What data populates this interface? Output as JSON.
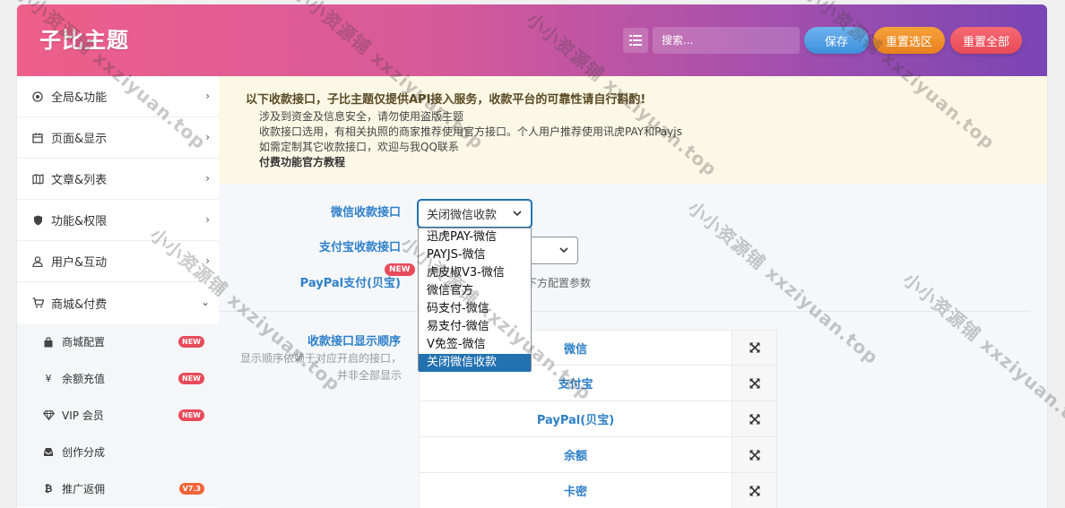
{
  "header": {
    "title": "子比主题",
    "search_placeholder": "搜索...",
    "save_label": "保存",
    "reset_section_label": "重置选区",
    "reset_all_label": "重置全部"
  },
  "sidebar": {
    "items": [
      {
        "label": "全局&功能",
        "icon": "target-icon"
      },
      {
        "label": "页面&显示",
        "icon": "calendar-icon"
      },
      {
        "label": "文章&列表",
        "icon": "map-icon"
      },
      {
        "label": "功能&权限",
        "icon": "shield-icon"
      },
      {
        "label": "用户&互动",
        "icon": "user-icon"
      },
      {
        "label": "商城&付费",
        "icon": "cart-icon"
      }
    ],
    "sub_items": [
      {
        "label": "商城配置",
        "icon": "shopping-bag-icon",
        "badge": "NEW"
      },
      {
        "label": "余额充值",
        "icon": "yen-icon",
        "badge": "NEW"
      },
      {
        "label": "VIP 会员",
        "icon": "diamond-icon",
        "badge": "NEW"
      },
      {
        "label": "创作分成",
        "icon": "inbox-icon",
        "badge": ""
      },
      {
        "label": "推广返佣",
        "icon": "bitcoin-icon",
        "badge": "V7.3"
      }
    ]
  },
  "notice": {
    "title": "以下收款接口，子比主题仅提供API接入服务，收款平台的可靠性请自行斟酌!",
    "lines": [
      "涉及到资金及信息安全，请勿使用盗版主题",
      "收款接口选用，有相关执照的商家推荐使用官方接口。个人用户推荐使用讯虎PAY和Payjs",
      "如需定制其它收款接口，欢迎与我QQ联系"
    ],
    "link": "付费功能官方教程"
  },
  "form": {
    "wechat_label": "微信收款接口",
    "wechat_value": "关闭微信收款",
    "alipay_label": "支付宝收款接口",
    "paypal_label": "PayPal支付(贝宝)",
    "paypal_badge": "NEW",
    "paypal_help": "下方配置参数",
    "wechat_options": [
      "迅虎PAY-微信",
      "PAYJS-微信",
      "虎皮椒V3-微信",
      "微信官方",
      "码支付-微信",
      "易支付-微信",
      "V免签-微信",
      "关闭微信收款"
    ],
    "order_label": "收款接口显示顺序",
    "order_desc": "显示顺序依赖于对应开启的接口，并非全部显示",
    "order_items": [
      "微信",
      "支付宝",
      "PayPal(贝宝)",
      "余额",
      "卡密"
    ]
  },
  "watermark": "小小资源铺 xxziyuan.top",
  "colors": {
    "accent": "#2f80c9",
    "badge": "#e84a5a",
    "save": "#4a9be2",
    "reset_section": "#ee8a25",
    "reset_all": "#ec5562"
  }
}
